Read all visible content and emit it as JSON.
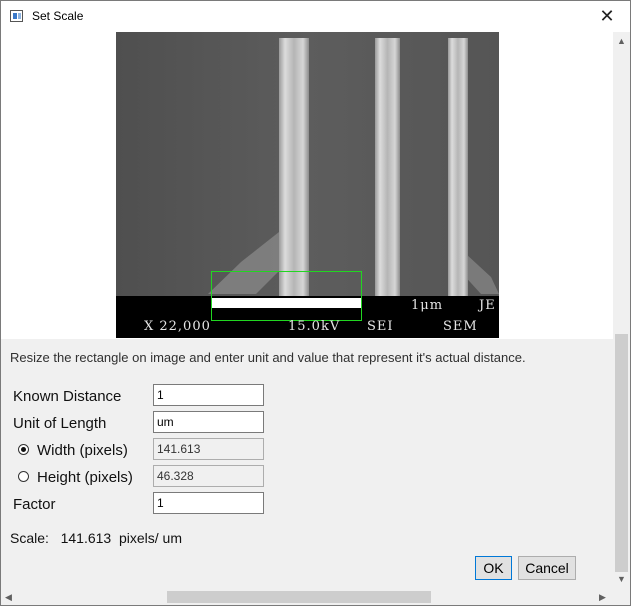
{
  "window": {
    "title": "Set Scale",
    "close_glyph": "✕"
  },
  "image": {
    "magnification": "X 22,000",
    "voltage": "15.0kV",
    "detector": "SEI",
    "scale_bar_label": "1μm",
    "brand": "JE",
    "instrument": "SEM"
  },
  "instruction": "Resize the rectangle on image and enter unit and value that represent it's actual distance.",
  "form": {
    "known_distance": {
      "label": "Known Distance",
      "value": "1"
    },
    "unit": {
      "label": "Unit of Length",
      "value": "um"
    },
    "width": {
      "label": "Width (pixels)",
      "value": "141.613",
      "selected": true
    },
    "height": {
      "label": "Height (pixels)",
      "value": "46.328",
      "selected": false
    },
    "factor": {
      "label": "Factor",
      "value": "1"
    }
  },
  "scale": {
    "label": "Scale:",
    "value": "141.613",
    "unit": "pixels/ um"
  },
  "buttons": {
    "ok": "OK",
    "cancel": "Cancel"
  },
  "scrollbars": {
    "up": "▲",
    "down": "▼",
    "left": "◀",
    "right": "▶"
  },
  "icons": {
    "app": "window-icon",
    "close": "close-icon",
    "radio": "radio-icon"
  },
  "colors": {
    "selection_rect": "#21d621",
    "primary_button_border": "#0078d7"
  }
}
